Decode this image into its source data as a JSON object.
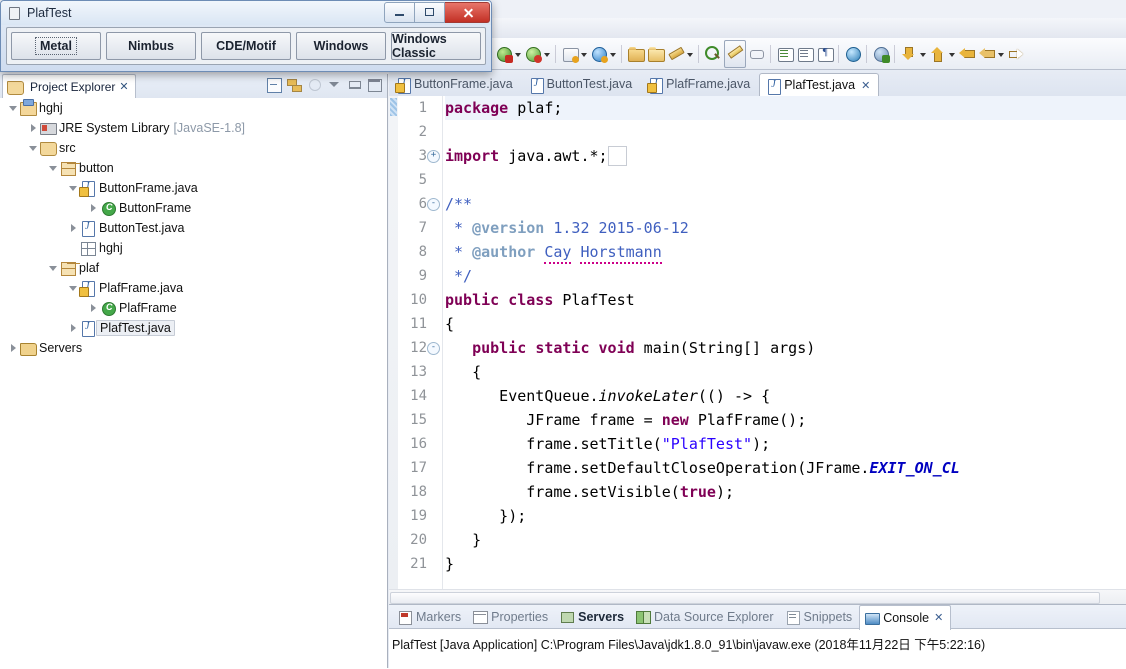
{
  "ide": {
    "toolbar_items": [
      {
        "name": "run-button",
        "icon": "run-icon"
      },
      {
        "name": "run-dropdown",
        "icon": "chevron-down-icon"
      },
      {
        "name": "debug-button",
        "icon": "debug-icon"
      },
      {
        "name": "debug-dropdown",
        "icon": "chevron-down-icon"
      },
      {
        "name": "new-wizard-button",
        "icon": "new-icon"
      },
      {
        "name": "new-wizard-dropdown",
        "icon": "chevron-down-icon"
      },
      {
        "name": "new-server-button",
        "icon": "server-new-icon"
      },
      {
        "name": "new-server-dropdown",
        "icon": "chevron-down-icon"
      },
      {
        "name": "open-type-button",
        "icon": "open-type-icon"
      },
      {
        "name": "open-resource-button",
        "icon": "open-resource-icon"
      },
      {
        "name": "external-tools-button",
        "icon": "external-tools-icon"
      },
      {
        "name": "external-tools-dropdown",
        "icon": "chevron-down-icon"
      },
      {
        "name": "search-button",
        "icon": "search-icon"
      },
      {
        "name": "editor-toggle-button",
        "icon": "pencil-icon"
      },
      {
        "name": "link-editor-button",
        "icon": "link-icon"
      },
      {
        "name": "next-annotation-button",
        "icon": "annotation-icon"
      },
      {
        "name": "toggle-block-selection-button",
        "icon": "block-select-icon"
      },
      {
        "name": "show-whitespace-button",
        "icon": "pilcrow-icon"
      },
      {
        "name": "web-browser-button",
        "icon": "globe-icon"
      },
      {
        "name": "profile-button",
        "icon": "profile-icon"
      },
      {
        "name": "previous-edit-button",
        "icon": "down-arrow-icon"
      },
      {
        "name": "previous-edit-dropdown",
        "icon": "chevron-down-icon"
      },
      {
        "name": "next-edit-button",
        "icon": "up-arrow-icon"
      },
      {
        "name": "next-edit-dropdown",
        "icon": "chevron-down-icon"
      },
      {
        "name": "back-button",
        "icon": "back-arrow-icon"
      },
      {
        "name": "forward-button",
        "icon": "forward-arrow-icon"
      },
      {
        "name": "history-dropdown",
        "icon": "chevron-down-icon"
      },
      {
        "name": "next-button",
        "icon": "next-arrow-icon"
      }
    ]
  },
  "project_explorer": {
    "title": "Project Explorer",
    "close_glyph": "✕",
    "tools": [
      {
        "name": "collapse-all-button",
        "icon": "collapse-all-icon"
      },
      {
        "name": "link-with-editor-button",
        "icon": "link-with-editor-icon"
      },
      {
        "name": "focus-on-active-task-button",
        "icon": "focus-task-icon"
      },
      {
        "name": "view-menu-button",
        "icon": "chevron-down-icon"
      },
      {
        "name": "minimize-button",
        "icon": "minimize-icon"
      },
      {
        "name": "maximize-button",
        "icon": "maximize-icon"
      }
    ],
    "tree": [
      {
        "label": "hghj",
        "sub": "",
        "indent": 0,
        "twist": "open",
        "icon": "project-icon",
        "selected": false
      },
      {
        "label": "JRE System Library",
        "sub": "[JavaSE-1.8]",
        "indent": 1,
        "twist": "closed",
        "icon": "jre-icon",
        "selected": false
      },
      {
        "label": "src",
        "sub": "",
        "indent": 1,
        "twist": "open",
        "icon": "source-folder-icon",
        "selected": false
      },
      {
        "label": "button",
        "sub": "",
        "indent": 2,
        "twist": "open",
        "icon": "package-icon",
        "selected": false
      },
      {
        "label": "ButtonFrame.java",
        "sub": "",
        "indent": 3,
        "twist": "open",
        "icon": "java-file-warning-icon",
        "selected": false
      },
      {
        "label": "ButtonFrame",
        "sub": "",
        "indent": 4,
        "twist": "closed",
        "icon": "class-icon",
        "selected": false
      },
      {
        "label": "ButtonTest.java",
        "sub": "",
        "indent": 3,
        "twist": "closed",
        "icon": "java-file-icon",
        "selected": false
      },
      {
        "label": "hghj",
        "sub": "",
        "indent": 3,
        "twist": "none",
        "icon": "empty-package-icon",
        "selected": false
      },
      {
        "label": "plaf",
        "sub": "",
        "indent": 2,
        "twist": "open",
        "icon": "package-icon",
        "selected": false
      },
      {
        "label": "PlafFrame.java",
        "sub": "",
        "indent": 3,
        "twist": "open",
        "icon": "java-file-warning-icon",
        "selected": false
      },
      {
        "label": "PlafFrame",
        "sub": "",
        "indent": 4,
        "twist": "closed",
        "icon": "class-icon",
        "selected": false
      },
      {
        "label": "PlafTest.java",
        "sub": "",
        "indent": 3,
        "twist": "closed",
        "icon": "java-file-icon",
        "selected": true
      },
      {
        "label": "Servers",
        "sub": "",
        "indent": 0,
        "twist": "closed",
        "icon": "servers-folder-icon",
        "selected": false
      }
    ]
  },
  "editor": {
    "tabs": [
      {
        "label": "ButtonFrame.java",
        "icon": "java-file-warning-icon",
        "active": false,
        "close": ""
      },
      {
        "label": "ButtonTest.java",
        "icon": "java-file-icon",
        "active": false,
        "close": ""
      },
      {
        "label": "PlafFrame.java",
        "icon": "java-file-warning-icon",
        "active": false,
        "close": ""
      },
      {
        "label": "PlafTest.java",
        "icon": "java-file-icon",
        "active": true,
        "close": "✕"
      }
    ],
    "line_numbers": [
      "1",
      "2",
      "3",
      "5",
      "6",
      "7",
      "8",
      "9",
      "10",
      "11",
      "12",
      "13",
      "14",
      "15",
      "16",
      "17",
      "18",
      "19",
      "20",
      "21"
    ],
    "fold_markers": {
      "3": "+",
      "6": "-",
      "12": "-"
    },
    "code_lines": [
      {
        "n": "1",
        "html": "<span class=\"kw\">package</span> plaf;",
        "hl": true
      },
      {
        "n": "2",
        "html": "",
        "hl": false
      },
      {
        "n": "3",
        "html": "<span class=\"kw\">import</span> java.awt.*;<span style=\"border:1px solid #c8ccd4;padding:0 4px;color:#888;\"> </span>",
        "hl": false
      },
      {
        "n": "5",
        "html": "",
        "hl": false
      },
      {
        "n": "6",
        "html": "<span class=\"jdoc\">/**</span>",
        "hl": false
      },
      {
        "n": "7",
        "html": "<span class=\"jdoc\"> * </span><span class=\"jdtag\">@version</span><span class=\"jdoc\"> 1.32 2015-06-12</span>",
        "hl": false
      },
      {
        "n": "8",
        "html": "<span class=\"jdoc\"> * </span><span class=\"jdtag\">@author</span><span class=\"jdoc\"> <span class=\"spell\">Cay</span> <span class=\"spell\">Horstmann</span></span>",
        "hl": false
      },
      {
        "n": "9",
        "html": "<span class=\"jdoc\"> */</span>",
        "hl": false
      },
      {
        "n": "10",
        "html": "<span class=\"kw\">public</span> <span class=\"kw\">class</span> PlafTest",
        "hl": false
      },
      {
        "n": "11",
        "html": "{",
        "hl": false
      },
      {
        "n": "12",
        "html": "   <span class=\"kw\">public</span> <span class=\"kw\">static</span> <span class=\"kw\">void</span> main(String[] args)",
        "hl": false
      },
      {
        "n": "13",
        "html": "   {",
        "hl": false
      },
      {
        "n": "14",
        "html": "      EventQueue.<span class=\"smeth\">invokeLater</span>(() -&gt; {",
        "hl": false
      },
      {
        "n": "15",
        "html": "         JFrame frame = <span class=\"kw\">new</span> PlafFrame();",
        "hl": false
      },
      {
        "n": "16",
        "html": "         frame.setTitle(<span class=\"str\">\"PlafTest\"</span>);",
        "hl": false
      },
      {
        "n": "17",
        "html": "         frame.setDefaultCloseOperation(JFrame.<span class=\"sfield\">EXIT_ON_CL</span>",
        "hl": false
      },
      {
        "n": "18",
        "html": "         frame.setVisible(<span class=\"kw\">true</span>);",
        "hl": false
      },
      {
        "n": "19",
        "html": "      });",
        "hl": false
      },
      {
        "n": "20",
        "html": "   }",
        "hl": false
      },
      {
        "n": "21",
        "html": "}",
        "hl": false
      }
    ],
    "code_plain": [
      "package plaf;",
      "",
      "import java.awt.*;",
      "",
      "/**",
      " * @version 1.32 2015-06-12",
      " * @author Cay Horstmann",
      " */",
      "public class PlafTest",
      "{",
      "   public static void main(String[] args)",
      "   {",
      "      EventQueue.invokeLater(() -> {",
      "         JFrame frame = new PlafFrame();",
      "         frame.setTitle(\"PlafTest\");",
      "         frame.setDefaultCloseOperation(JFrame.EXIT_ON_CL",
      "         frame.setVisible(true);",
      "      });",
      "   }",
      "}"
    ]
  },
  "bottom_panel": {
    "tabs": [
      {
        "label": "Markers",
        "icon": "markers-icon",
        "active": false,
        "bold": false,
        "close": ""
      },
      {
        "label": "Properties",
        "icon": "properties-icon",
        "active": false,
        "bold": false,
        "close": ""
      },
      {
        "label": "Servers",
        "icon": "servers-icon",
        "active": false,
        "bold": true,
        "close": ""
      },
      {
        "label": "Data Source Explorer",
        "icon": "data-source-icon",
        "active": false,
        "bold": false,
        "close": ""
      },
      {
        "label": "Snippets",
        "icon": "snippets-icon",
        "active": false,
        "bold": false,
        "close": ""
      },
      {
        "label": "Console",
        "icon": "console-icon",
        "active": true,
        "bold": false,
        "close": "✕"
      }
    ],
    "console_line": "PlafTest [Java Application] C:\\Program Files\\Java\\jdk1.8.0_91\\bin\\javaw.exe (2018年11月22日 下午5:22:16)"
  },
  "plaf_window": {
    "title": "PlafTest",
    "icon": "java-coffee-cup-icon",
    "window_buttons": [
      {
        "name": "minimize-button",
        "glyph": "minimize"
      },
      {
        "name": "maximize-button",
        "glyph": "maximize"
      },
      {
        "name": "close-button",
        "glyph": "close"
      }
    ],
    "buttons": [
      {
        "label": "Metal",
        "focused": true
      },
      {
        "label": "Nimbus",
        "focused": false
      },
      {
        "label": "CDE/Motif",
        "focused": false
      },
      {
        "label": "Windows",
        "focused": false
      },
      {
        "label": "Windows Classic",
        "focused": false
      }
    ]
  },
  "colors": {
    "keyword": "#7F0055",
    "string": "#2A00FF",
    "javadoc": "#3F5FBF",
    "javadoc_tag": "#7F9FBF",
    "static_field": "#0000C0",
    "close_button_red": "#C23025",
    "selection_highlight": "#EEF3FB"
  }
}
